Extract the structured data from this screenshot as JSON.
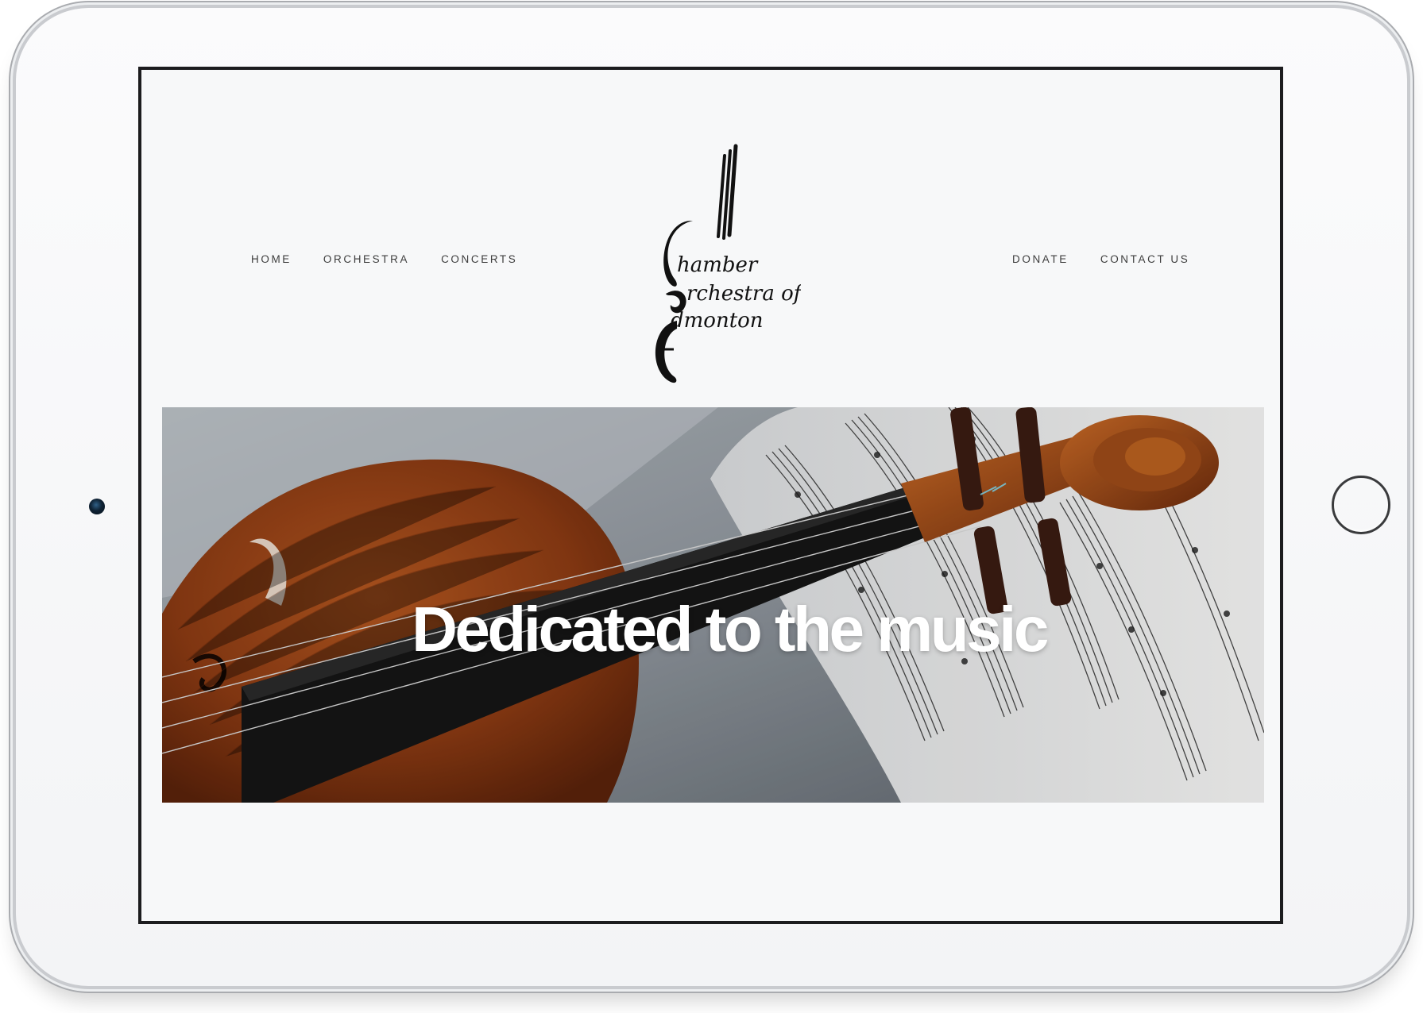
{
  "nav": {
    "left": [
      {
        "label": "HOME"
      },
      {
        "label": "ORCHESTRA"
      },
      {
        "label": "CONCERTS"
      }
    ],
    "right": [
      {
        "label": "DONATE"
      },
      {
        "label": "CONTACT US"
      }
    ]
  },
  "logo": {
    "line1": "hamber",
    "line2": "rchestra of",
    "line3": "dmonton",
    "name": "Chamber Orchestra of Edmonton"
  },
  "hero": {
    "title": "Dedicated to the music"
  },
  "colors": {
    "page_background": "#f7f8f9",
    "nav_text": "#3d3d3d",
    "violin": "#8a3a13",
    "hero_text": "#ffffff"
  }
}
